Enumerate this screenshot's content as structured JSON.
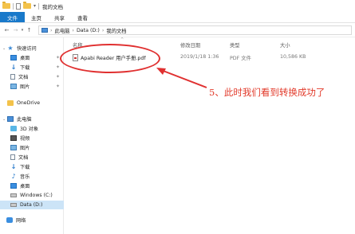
{
  "window": {
    "title": "我的文档"
  },
  "ribbon": {
    "tabs": [
      "文件",
      "主页",
      "共享",
      "查看"
    ]
  },
  "address": {
    "parts": [
      "此电脑",
      "Data (D:)",
      "我的文档"
    ]
  },
  "sidebar": {
    "quick_access": "快速访问",
    "quick_items": [
      "桌面",
      "下载",
      "文档",
      "图片"
    ],
    "onedrive": "OneDrive",
    "this_pc": "此电脑",
    "pc_items": [
      "3D 对象",
      "视频",
      "图片",
      "文档",
      "下载",
      "音乐",
      "桌面",
      "Windows (C:)",
      "Data (D:)"
    ],
    "network": "网络"
  },
  "columns": {
    "name": "名称",
    "modified": "修改日期",
    "type": "类型",
    "size": "大小"
  },
  "files": [
    {
      "name": "Apabi Reader 用户手册.pdf",
      "modified": "2019/1/18 1:36",
      "type": "PDF 文件",
      "size": "10,586 KB"
    }
  ],
  "annotation": {
    "text": "5、此时我们看到转换成功了",
    "color": "#e23a2a"
  }
}
